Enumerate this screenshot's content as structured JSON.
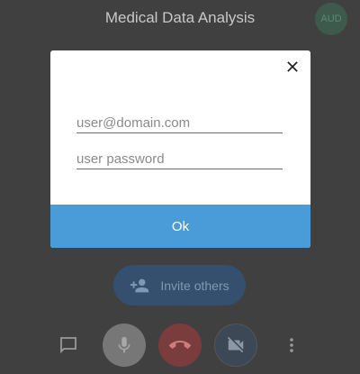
{
  "header": {
    "title": "Medical Data Analysis",
    "avatar_initials": "AUD"
  },
  "dialog": {
    "email_placeholder": "user@domain.com",
    "password_placeholder": "user password",
    "email_value": "",
    "password_value": "",
    "ok_label": "Ok"
  },
  "invite": {
    "label": "Invite others"
  },
  "toolbar": {
    "icons": [
      "chat-icon",
      "microphone-icon",
      "hang-up-icon",
      "camera-off-icon",
      "more-vertical-icon"
    ]
  },
  "colors": {
    "background": "#404040",
    "ok_button": "#4a9cd8",
    "end_call": "#7a3c3c",
    "invite_button": "#34506e"
  }
}
